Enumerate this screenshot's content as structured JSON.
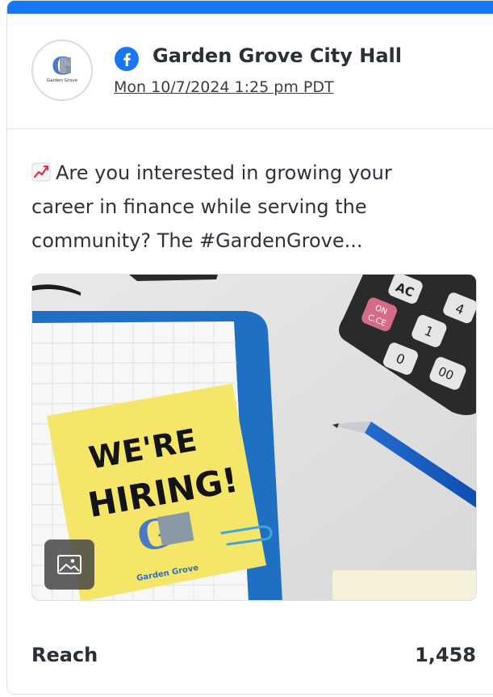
{
  "post": {
    "page_name": "Garden Grove City Hall",
    "date": "Mon 10/7/2024 1:25 pm PDT",
    "text": "Are you interested in growing your career in finance while serving the community? The #GardenGrove...",
    "logo_small_text": "Garden Grove",
    "image": {
      "sticky_line1": "WE'RE",
      "sticky_line2": "HIRING!",
      "sticky_brand": "Garden Grove",
      "calc_ac": "AC",
      "calc_on_line1": "ON",
      "calc_on_line2": "C.CE",
      "calc_four": "4",
      "calc_one": "1",
      "calc_zero": "0",
      "calc_double_zero": "00"
    }
  },
  "stats": {
    "reach_label": "Reach",
    "reach_value": "1,458"
  },
  "colors": {
    "facebook_blue": "#1877f2",
    "sticky_yellow": "#f5e66a",
    "folder_blue": "#1f6fc3"
  },
  "icons": [
    "facebook-icon",
    "trend-chart-icon",
    "image-icon"
  ]
}
